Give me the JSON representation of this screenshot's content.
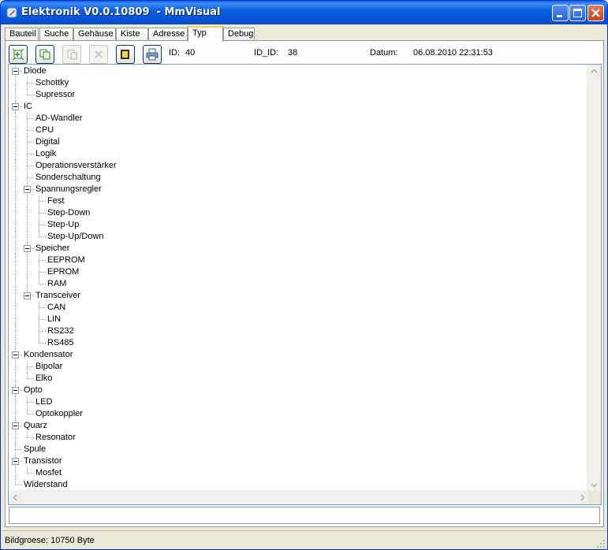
{
  "window": {
    "title": "Elektronik V0.0.10809  - MmVisual",
    "controls": [
      "minimize",
      "maximize",
      "close"
    ]
  },
  "tabs": [
    {
      "label": "Bauteil",
      "active": false
    },
    {
      "label": "Suche",
      "active": false
    },
    {
      "label": "Gehäuse",
      "active": false
    },
    {
      "label": "Kiste",
      "active": false
    },
    {
      "label": "Adresse",
      "active": false
    },
    {
      "label": "Typ",
      "active": true
    },
    {
      "label": "Debug",
      "active": false
    }
  ],
  "toolbar": {
    "buttons": [
      {
        "icon": "add-node-icon",
        "enabled": true
      },
      {
        "icon": "copy-icon",
        "enabled": true
      },
      {
        "icon": "paste-icon",
        "enabled": false
      },
      {
        "icon": "delete-icon",
        "enabled": false
      },
      {
        "icon": "folder-icon",
        "enabled": true
      },
      {
        "icon": "printer-icon",
        "enabled": true
      }
    ],
    "id_label": "ID:",
    "id_value": "40",
    "id_id_label": "ID_ID:",
    "id_id_value": "38",
    "datum_label": "Datum:",
    "datum_value": "06.08.2010 22:31:53"
  },
  "tree": [
    {
      "label": "Diode",
      "expanded": true,
      "children": [
        {
          "label": "Schottky"
        },
        {
          "label": "Supressor"
        }
      ]
    },
    {
      "label": "IC",
      "expanded": true,
      "children": [
        {
          "label": "AD-Wandler"
        },
        {
          "label": "CPU"
        },
        {
          "label": "Digital"
        },
        {
          "label": "Logik"
        },
        {
          "label": "Operationsverstärker"
        },
        {
          "label": "Sonderschaltung"
        },
        {
          "label": "Spannungsregler",
          "expanded": true,
          "children": [
            {
              "label": "Fest"
            },
            {
              "label": "Step-Down"
            },
            {
              "label": "Step-Up"
            },
            {
              "label": "Step-Up/Down"
            }
          ]
        },
        {
          "label": "Speicher",
          "expanded": true,
          "children": [
            {
              "label": "EEPROM"
            },
            {
              "label": "EPROM"
            },
            {
              "label": "RAM"
            }
          ]
        },
        {
          "label": "Transceiver",
          "expanded": true,
          "children": [
            {
              "label": "CAN"
            },
            {
              "label": "LIN"
            },
            {
              "label": "RS232"
            },
            {
              "label": "RS485"
            }
          ]
        }
      ]
    },
    {
      "label": "Kondensator",
      "expanded": true,
      "children": [
        {
          "label": "Bipolar"
        },
        {
          "label": "Elko"
        }
      ]
    },
    {
      "label": "Opto",
      "expanded": true,
      "children": [
        {
          "label": "LED"
        },
        {
          "label": "Optokoppler"
        }
      ]
    },
    {
      "label": "Quarz",
      "expanded": true,
      "children": [
        {
          "label": "Resonator"
        }
      ]
    },
    {
      "label": "Spule"
    },
    {
      "label": "Transistor",
      "expanded": true,
      "children": [
        {
          "label": "Mosfet"
        }
      ]
    },
    {
      "label": "Widerstand"
    }
  ],
  "input": {
    "value": ""
  },
  "status": {
    "text": "Bildgroese: 10750 Byte"
  }
}
